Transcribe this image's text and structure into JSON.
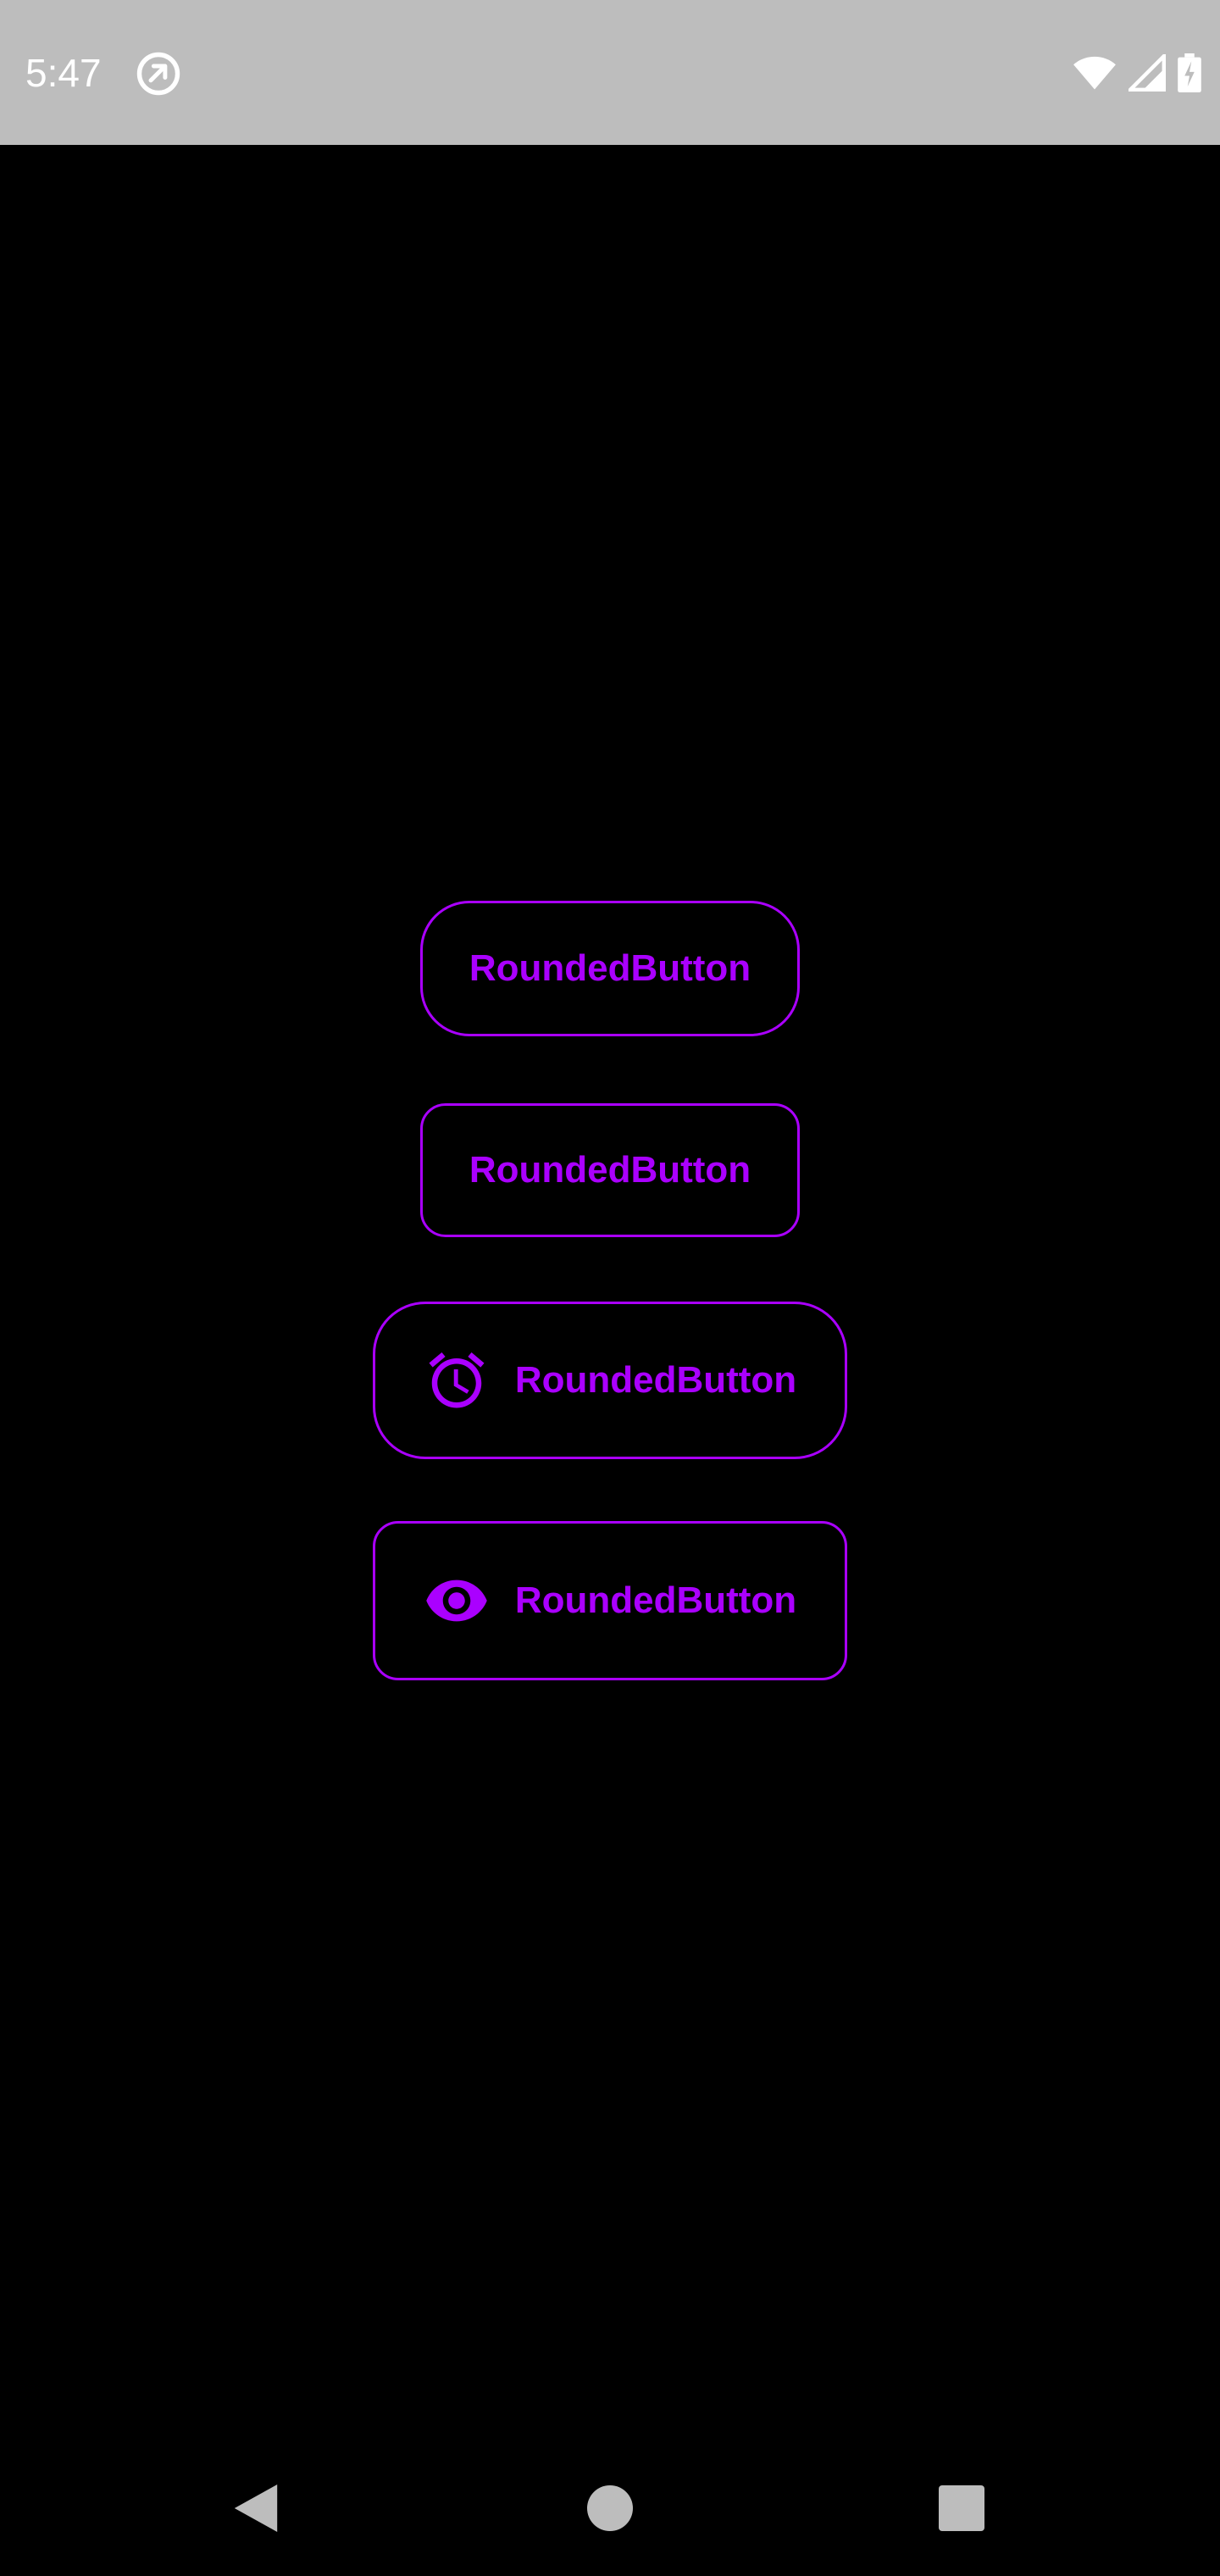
{
  "status_bar": {
    "time": "5:47",
    "icons": [
      "sync-icon",
      "wifi-icon",
      "signal-icon",
      "battery-charging-icon"
    ]
  },
  "colors": {
    "accent": "#aa00ff",
    "background": "#000000",
    "status_bar": "#bdbdbd",
    "nav_icons": "#bdbdbd"
  },
  "buttons": [
    {
      "label": "RoundedButton",
      "icon": null,
      "style": "pill"
    },
    {
      "label": "RoundedButton",
      "icon": null,
      "style": "rounded-rect"
    },
    {
      "label": "RoundedButton",
      "icon": "alarm-icon",
      "style": "pill"
    },
    {
      "label": "RoundedButton",
      "icon": "eye-icon",
      "style": "rounded-rect"
    }
  ],
  "nav_bar": {
    "items": [
      "back-icon",
      "home-icon",
      "recents-icon"
    ]
  }
}
